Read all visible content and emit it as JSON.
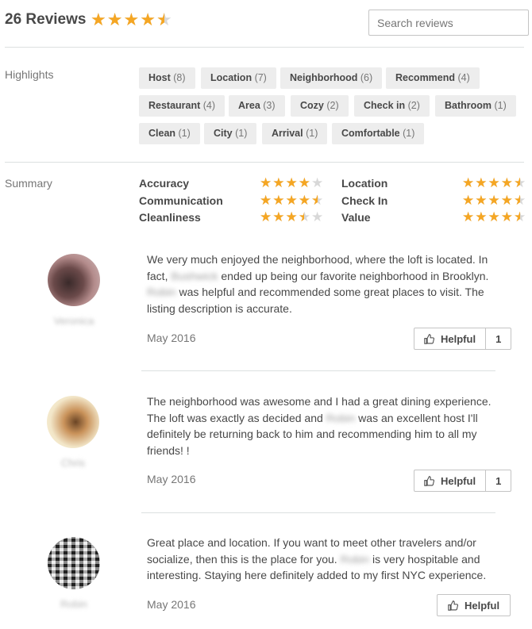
{
  "header": {
    "review_count": "26 Reviews",
    "overall_rating": 4.5,
    "search_placeholder": "Search reviews"
  },
  "highlights": {
    "label": "Highlights",
    "chips": [
      {
        "label": "Host",
        "count": "(8)"
      },
      {
        "label": "Location",
        "count": "(7)"
      },
      {
        "label": "Neighborhood",
        "count": "(6)"
      },
      {
        "label": "Recommend",
        "count": "(4)"
      },
      {
        "label": "Restaurant",
        "count": "(4)"
      },
      {
        "label": "Area",
        "count": "(3)"
      },
      {
        "label": "Cozy",
        "count": "(2)"
      },
      {
        "label": "Check in",
        "count": "(2)"
      },
      {
        "label": "Bathroom",
        "count": "(1)"
      },
      {
        "label": "Clean",
        "count": "(1)"
      },
      {
        "label": "City",
        "count": "(1)"
      },
      {
        "label": "Arrival",
        "count": "(1)"
      },
      {
        "label": "Comfortable",
        "count": "(1)"
      }
    ]
  },
  "summary": {
    "label": "Summary",
    "ratings": [
      {
        "label": "Accuracy",
        "stars": 4
      },
      {
        "label": "Location",
        "stars": 4.5
      },
      {
        "label": "Communication",
        "stars": 4.5
      },
      {
        "label": "Check In",
        "stars": 4.5
      },
      {
        "label": "Cleanliness",
        "stars": 3.5
      },
      {
        "label": "Value",
        "stars": 4.5
      }
    ]
  },
  "reviews": [
    {
      "name": "Veronica",
      "date": "May 2016",
      "text_parts": [
        "We very much enjoyed the neighborhood, where the loft is located. In fact, ",
        {
          "blur": "Bushwick"
        },
        " ended up being our favorite neighborhood in Brooklyn. ",
        {
          "blur": "Robin"
        },
        " was helpful and recommended some great places to visit. The listing description is accurate."
      ],
      "helpful_label": "Helpful",
      "helpful_count": "1"
    },
    {
      "name": "Chris",
      "date": "May 2016",
      "text_parts": [
        "The neighborhood was awesome and I had a great dining experience. The loft was exactly as decided and ",
        {
          "blur": "Robin"
        },
        " was an excellent host I'll definitely be returning back to him and recommending him to all my friends! !"
      ],
      "helpful_label": "Helpful",
      "helpful_count": "1"
    },
    {
      "name": "Robin",
      "date": "May 2016",
      "text_parts": [
        "Great place and location. If you want to meet other travelers and/or socialize, then this is the place for you. ",
        {
          "blur": "Robin"
        },
        " is very hospitable and interesting. Staying here definitely added to my first NYC experience."
      ],
      "helpful_label": "Helpful",
      "helpful_count": ""
    }
  ],
  "colors": {
    "star": "#f5a623",
    "star_empty": "#d8d8d8",
    "chip_bg": "#ededed",
    "text": "#484848",
    "muted": "#767676"
  },
  "icons": {
    "star": "star-icon",
    "thumbs_up": "thumbs-up-icon"
  }
}
